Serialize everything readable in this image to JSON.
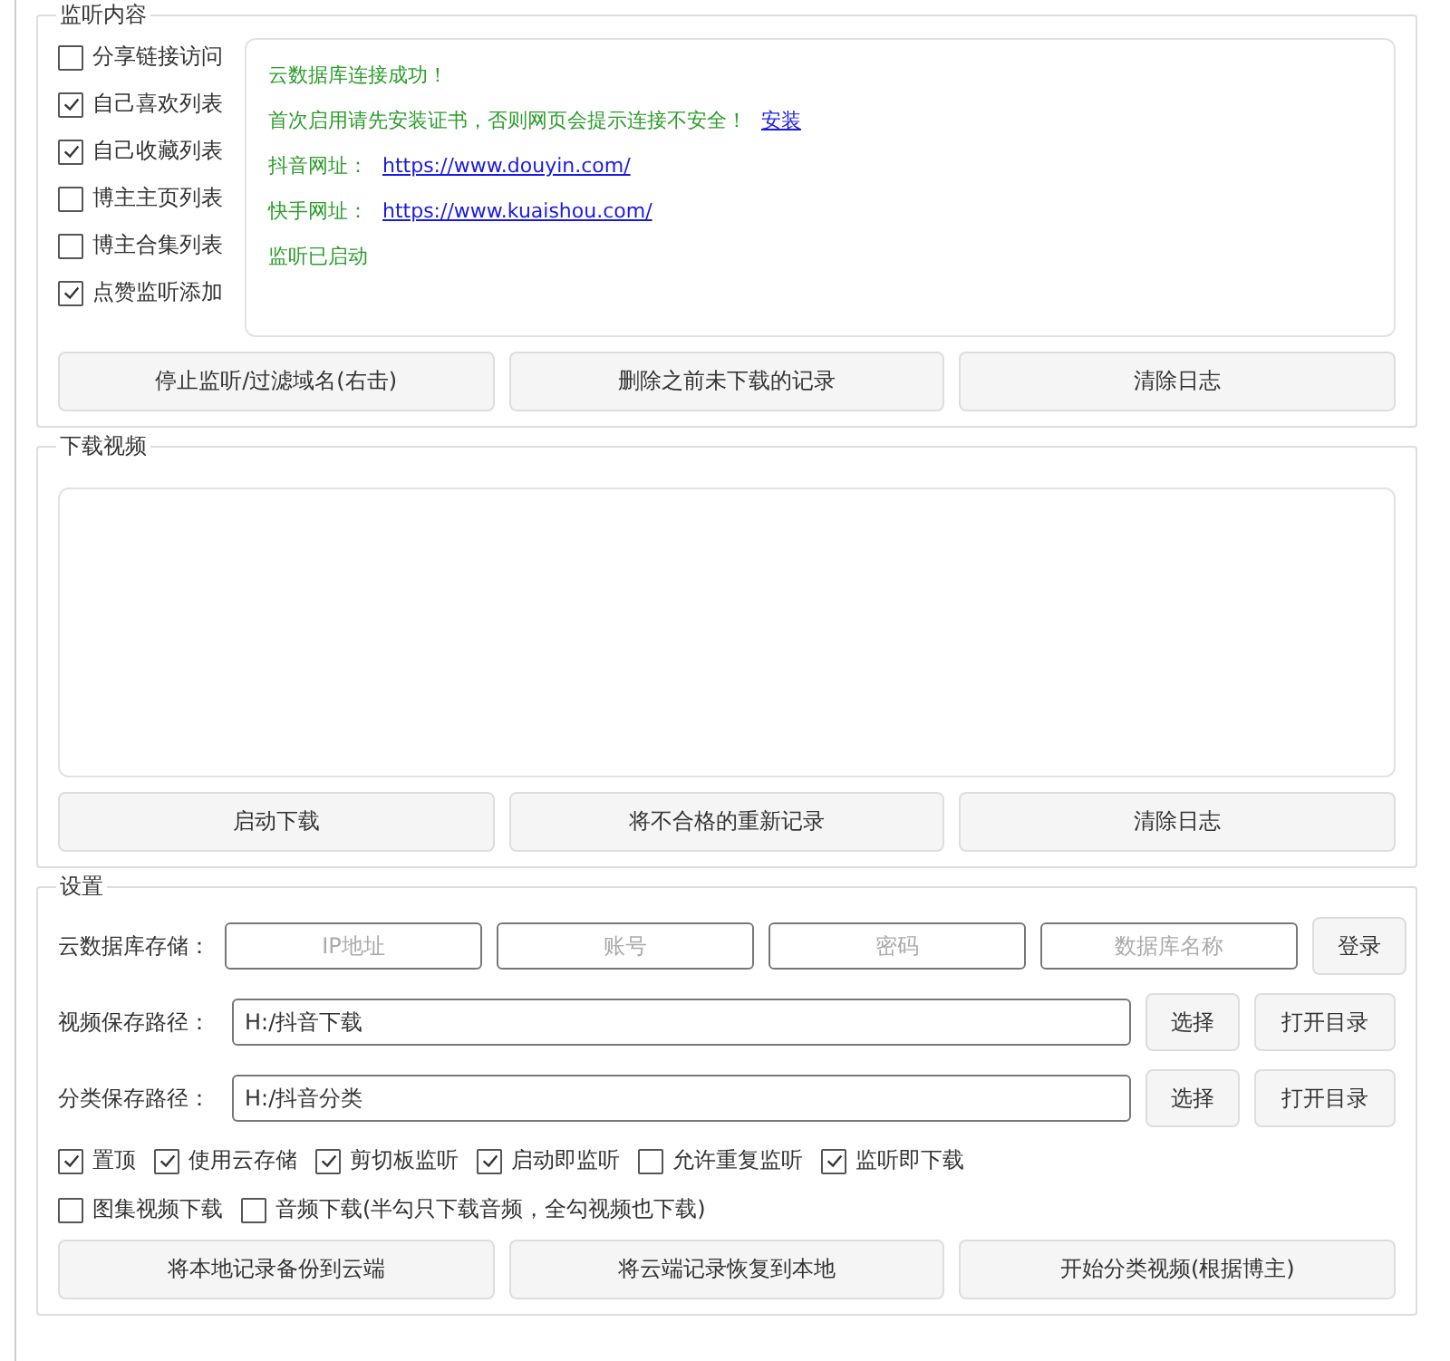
{
  "monitor": {
    "title": "监听内容",
    "options": [
      {
        "label": "分享链接访问",
        "checked": false
      },
      {
        "label": "自己喜欢列表",
        "checked": true
      },
      {
        "label": "自己收藏列表",
        "checked": true
      },
      {
        "label": "博主主页列表",
        "checked": false
      },
      {
        "label": "博主合集列表",
        "checked": false
      },
      {
        "label": "点赞监听添加",
        "checked": true
      }
    ],
    "log": [
      {
        "text": "云数据库连接成功！"
      },
      {
        "text": "首次启用请先安装证书，否则网页会提示连接不安全！",
        "link": "安装"
      },
      {
        "text": "抖音网址：",
        "link": "https://www.douyin.com/"
      },
      {
        "text": "快手网址：",
        "link": "https://www.kuaishou.com/"
      },
      {
        "text": "监听已启动"
      }
    ],
    "buttons": [
      "停止监听/过滤域名(右击)",
      "删除之前未下载的记录",
      "清除日志"
    ]
  },
  "download": {
    "title": "下载视频",
    "buttons": [
      "启动下载",
      "将不合格的重新记录",
      "清除日志"
    ]
  },
  "settings": {
    "title": "设置",
    "cloud": {
      "label": "云数据库存储：",
      "fields": [
        {
          "placeholder": "IP地址"
        },
        {
          "placeholder": "账号"
        },
        {
          "placeholder": "密码"
        },
        {
          "placeholder": "数据库名称"
        }
      ],
      "button": "登录"
    },
    "paths": [
      {
        "label": "视频保存路径：",
        "value": "H:/抖音下载",
        "buttons": [
          "选择",
          "打开目录"
        ]
      },
      {
        "label": "分类保存路径：",
        "value": "H:/抖音分类",
        "buttons": [
          "选择",
          "打开目录"
        ]
      }
    ],
    "option_rows": [
      [
        {
          "label": "置顶",
          "checked": true
        },
        {
          "label": "使用云存储",
          "checked": true
        },
        {
          "label": "剪切板监听",
          "checked": true
        },
        {
          "label": "启动即监听",
          "checked": true
        },
        {
          "label": "允许重复监听",
          "checked": false
        },
        {
          "label": "监听即下载",
          "checked": true
        }
      ],
      [
        {
          "label": "图集视频下载",
          "checked": false
        },
        {
          "label": "音频下载(半勾只下载音频，全勾视频也下载)",
          "checked": false
        }
      ]
    ],
    "buttons": [
      "将本地记录备份到云端",
      "将云端记录恢复到本地",
      "开始分类视频(根据博主)"
    ]
  }
}
